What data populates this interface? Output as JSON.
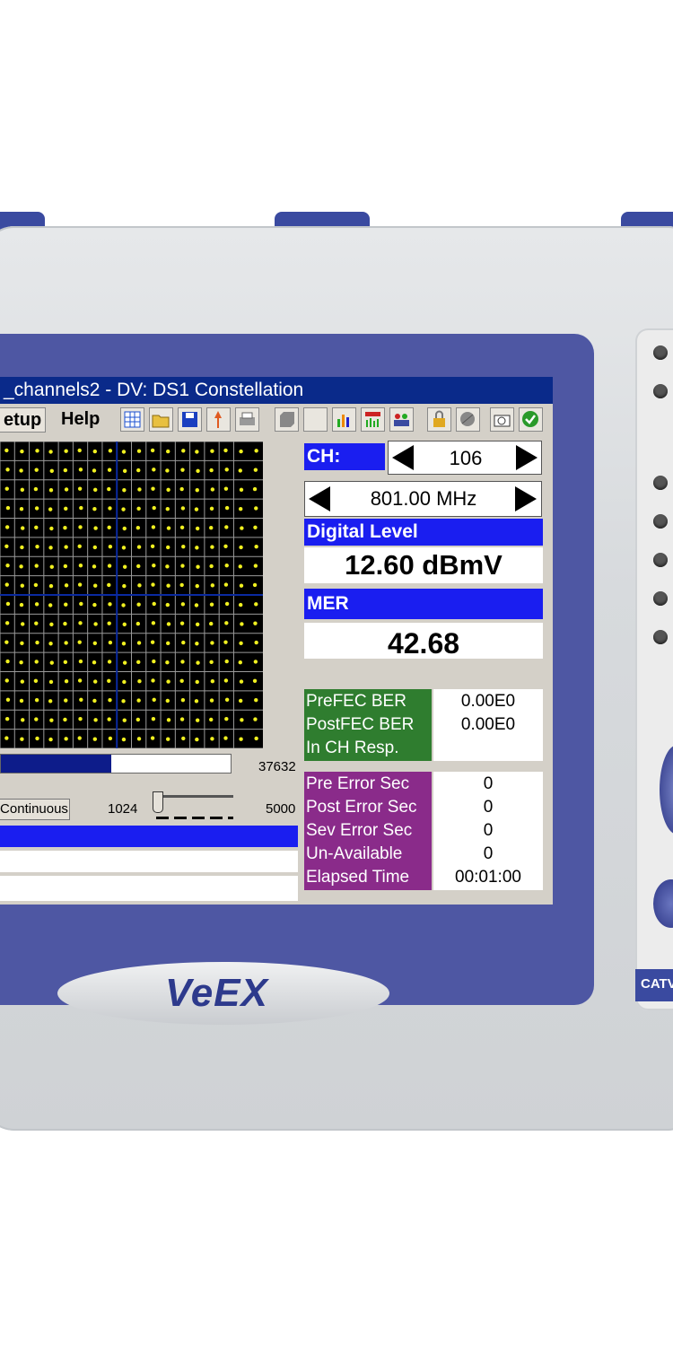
{
  "window": {
    "title": "_channels2 - DV: DS1 Constellation"
  },
  "menu": {
    "setup": "etup",
    "help": "Help"
  },
  "toolbar": {
    "icons": [
      "grid-icon",
      "folder-open-icon",
      "save-icon",
      "pin-icon",
      "print-icon",
      "gray-box-icon",
      "blank-icon",
      "bar-chart-icon",
      "spectrum-icon",
      "network-icon",
      "lock-icon",
      "globe-icon",
      "camera-icon",
      "check-icon"
    ]
  },
  "constellation": {
    "grid_size": 16,
    "point_color": "#f0f020",
    "axis_color": "#0a2aa0",
    "progress_max_label": "37632",
    "progress_fraction": 0.48,
    "mode_button": "Continuous",
    "slider_min": "1024",
    "slider_max": "5000"
  },
  "channel": {
    "label": "CH:",
    "number": "106",
    "frequency": "801.00 MHz"
  },
  "digital_level": {
    "label": "Digital Level",
    "value": "12.60 dBmV"
  },
  "mer": {
    "label": "MER",
    "value": "42.68"
  },
  "ber": {
    "rows": [
      {
        "label": "PreFEC BER",
        "value": "0.00E0"
      },
      {
        "label": "PostFEC BER",
        "value": "0.00E0"
      },
      {
        "label": "In CH Resp.",
        "value": ""
      }
    ]
  },
  "errors": {
    "rows": [
      {
        "label": "Pre Error Sec",
        "value": "0"
      },
      {
        "label": "Post Error Sec",
        "value": "0"
      },
      {
        "label": "Sev Error Sec",
        "value": "0"
      },
      {
        "label": "Un-Available",
        "value": "0"
      },
      {
        "label": "Elapsed Time",
        "value": "00:01:00"
      }
    ]
  },
  "device": {
    "brand": "VeEX",
    "side_label": "CATV"
  },
  "colors": {
    "bezel": "#4e57a3",
    "title_bar": "#0a2a8a",
    "highlight_blue": "#1a1ef0",
    "ber_green": "#2f7d2f",
    "error_purple": "#8a2b8a"
  }
}
